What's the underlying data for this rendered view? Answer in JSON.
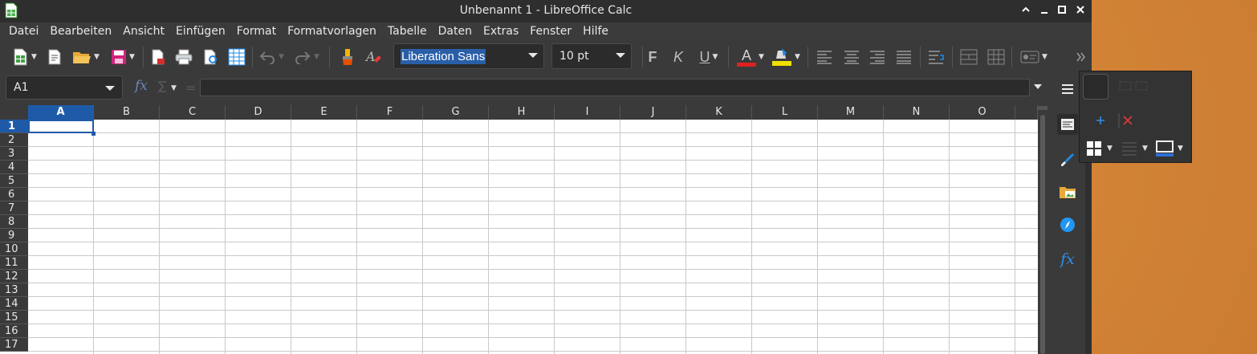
{
  "window": {
    "title": "Unbenannt 1 - LibreOffice Calc",
    "controls": [
      "minimize-up",
      "minimize",
      "maximize",
      "close"
    ]
  },
  "menubar": {
    "items": [
      "Datei",
      "Bearbeiten",
      "Ansicht",
      "Einfügen",
      "Format",
      "Formatvorlagen",
      "Tabelle",
      "Daten",
      "Extras",
      "Fenster",
      "Hilfe"
    ]
  },
  "toolbar": {
    "font_name": "Liberation Sans",
    "font_size": "10 pt",
    "bold_label": "F",
    "italic_label": "K",
    "underline_label": "U",
    "font_color_label": "A"
  },
  "formula": {
    "cell_ref": "A1",
    "fx_label": "fx",
    "input_value": ""
  },
  "sheet": {
    "columns": [
      "A",
      "B",
      "C",
      "D",
      "E",
      "F",
      "G",
      "H",
      "I",
      "J",
      "K",
      "L",
      "M",
      "N",
      "O"
    ],
    "rows": [
      "1",
      "2",
      "3",
      "4",
      "5",
      "6",
      "7",
      "8",
      "9",
      "10",
      "11",
      "12",
      "13",
      "14",
      "15",
      "16",
      "17"
    ],
    "active_column": "A",
    "active_row": "1"
  },
  "sidebar": {
    "fx_label": "fx"
  },
  "colors": {
    "accent": "#1f5aa8",
    "window_bg": "#3a3a3a",
    "desktop": "#c97a30",
    "font_color_bar": "#e02020",
    "highlight_bar": "#f0e000"
  }
}
